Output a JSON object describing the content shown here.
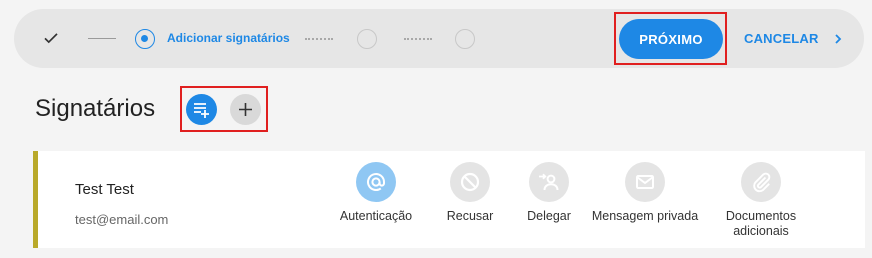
{
  "stepper": {
    "active_step_label": "Adicionar signatários",
    "next_label": "PRÓXIMO",
    "cancel_label": "CANCELAR"
  },
  "section": {
    "title": "Signatários"
  },
  "signer": {
    "name": "Test Test",
    "email": "test@email.com",
    "actions": [
      {
        "label": "Autenticação",
        "icon": "at-icon",
        "active": true
      },
      {
        "label": "Recusar",
        "icon": "block-icon",
        "active": false
      },
      {
        "label": "Delegar",
        "icon": "delegate-icon",
        "active": false
      },
      {
        "label": "Mensagem privada",
        "icon": "mail-icon",
        "active": false
      },
      {
        "label": "Documentos adicionais",
        "icon": "paperclip-icon",
        "active": false
      }
    ]
  },
  "colors": {
    "accent": "#1e88e5",
    "highlight": "#e01f1f",
    "card_border": "#b9a92a"
  }
}
